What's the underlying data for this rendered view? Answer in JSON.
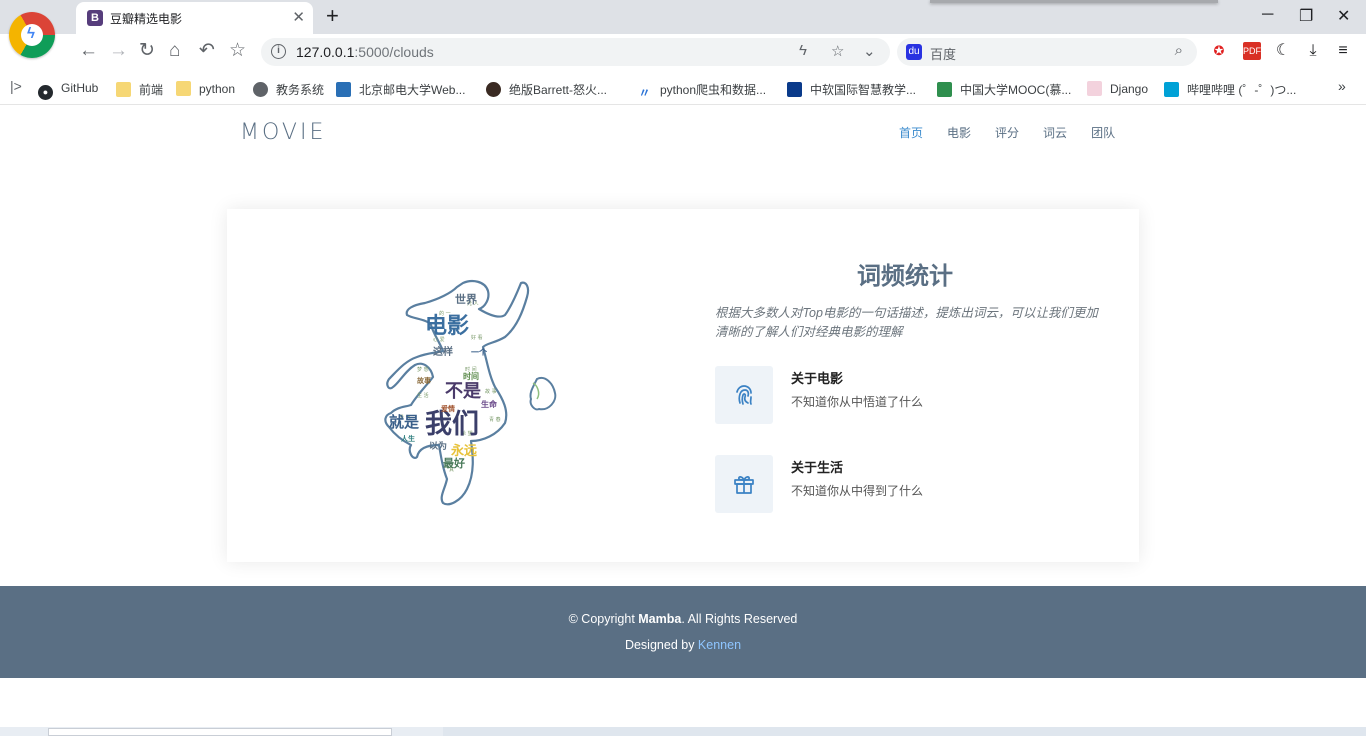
{
  "browser": {
    "tab": {
      "favicon": "B",
      "title": "豆瓣精选电影",
      "close": "✕"
    },
    "new_tab": "+",
    "window": {
      "minimize": "─",
      "restore": "❐",
      "close": "✕"
    },
    "nav": {
      "back": "←",
      "forward": "→",
      "reload": "↻",
      "home": "⌂",
      "undo": "↶",
      "bookmark": "☆"
    },
    "address": {
      "host": "127.0.0.1",
      "path": ":5000/clouds"
    },
    "search": {
      "placeholder": "百度"
    },
    "bookmarks": [
      {
        "label": "GitHub",
        "icon": "github-icon"
      },
      {
        "label": "前端",
        "icon": "folder-icon"
      },
      {
        "label": "python",
        "icon": "folder-icon"
      },
      {
        "label": "教务系统",
        "icon": "globe-icon"
      },
      {
        "label": "北京邮电大学Web...",
        "icon": "site-icon"
      },
      {
        "label": "绝版Barrett-怒火...",
        "icon": "avatar-icon"
      },
      {
        "label": "python爬虫和数据...",
        "icon": "site-icon"
      },
      {
        "label": "中软国际智慧教学...",
        "icon": "site-icon"
      },
      {
        "label": "中国大学MOOC(慕...",
        "icon": "site-icon"
      },
      {
        "label": "Django",
        "icon": "site-icon"
      },
      {
        "label": "哔哩哔哩 (゜-゜)つ...",
        "icon": "bilibili-icon"
      }
    ],
    "bookmarks_more": "»"
  },
  "site": {
    "brand": "MOVIE",
    "nav": [
      {
        "label": "首页",
        "active": true
      },
      {
        "label": "电影",
        "active": false
      },
      {
        "label": "评分",
        "active": false
      },
      {
        "label": "词云",
        "active": false
      },
      {
        "label": "团队",
        "active": false
      }
    ]
  },
  "card": {
    "title": "词频统计",
    "lead": "根据大多数人对Top电影的一句话描述，提炼出词云，可以让我们更加清晰的了解人们对经典电影的理解",
    "wordcloud": {
      "words": [
        "世界",
        "电影",
        "这样",
        "不是",
        "就是",
        "我们",
        "永远",
        "以为",
        "最好",
        "一个",
        "爱情",
        "人生",
        "生命",
        "时间",
        "故事"
      ]
    },
    "features": [
      {
        "icon": "fingerprint-icon",
        "title": "关于电影",
        "desc": "不知道你从中悟道了什么"
      },
      {
        "icon": "gift-icon",
        "title": "关于生活",
        "desc": "不知道你从中得到了什么"
      }
    ]
  },
  "footer": {
    "copyright_prefix": "© Copyright ",
    "owner": "Mamba",
    "copyright_suffix": ". All Rights Reserved",
    "designed_prefix": "Designed by ",
    "designer": "Kennen"
  }
}
